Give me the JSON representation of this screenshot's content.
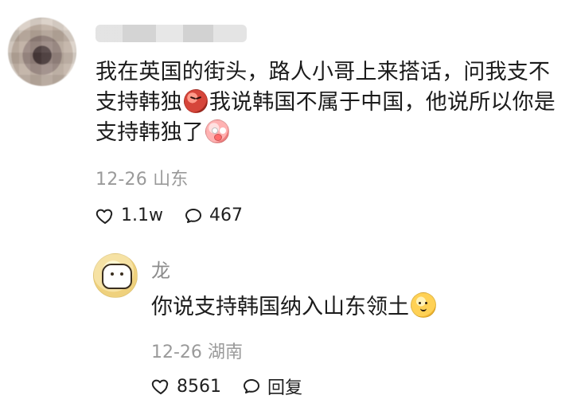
{
  "comment": {
    "username": "",
    "text": {
      "line1": "我在英国的街头，路人小哥上来搭话，问我支不",
      "line2_before": "支持韩独",
      "line2_after": "我说韩国不属于中国，他说所以你是",
      "line3": "支持韩独了"
    },
    "date": "12-26",
    "location": "山东",
    "likes": "1.1w",
    "comments": "467",
    "icons": {
      "angry_emoji": "angry-emoji",
      "shock_emoji": "shock-emoji",
      "like": "heart-outline-icon",
      "comment": "speech-bubble-icon"
    }
  },
  "reply": {
    "username": "龙",
    "text_before": "你说支持韩国纳入山东领土",
    "date": "12-26",
    "location": "湖南",
    "likes": "8561",
    "reply_label": "回复",
    "icons": {
      "mango_emoji": "mango-emoji",
      "like": "heart-outline-icon",
      "reply": "speech-bubble-icon"
    }
  }
}
